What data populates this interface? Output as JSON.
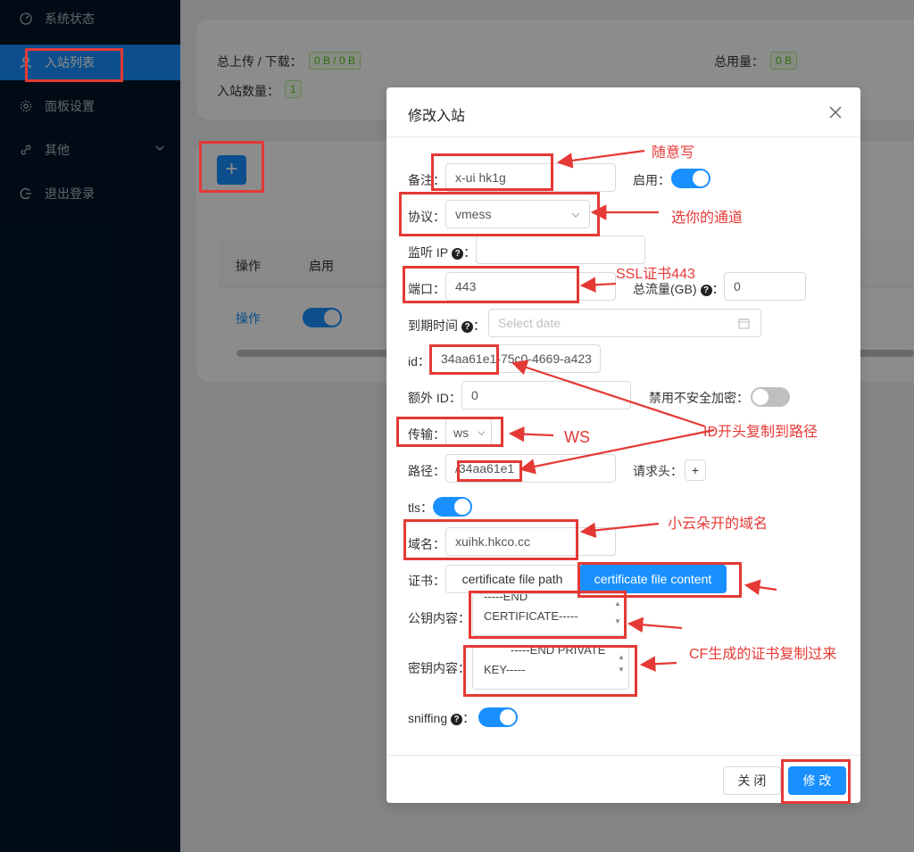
{
  "sidebar": {
    "items": [
      {
        "label": "系统状态",
        "icon": "dashboard-icon"
      },
      {
        "label": "入站列表",
        "icon": "user-icon"
      },
      {
        "label": "面板设置",
        "icon": "gear-icon"
      },
      {
        "label": "其他",
        "icon": "link-icon"
      },
      {
        "label": "退出登录",
        "icon": "logout-icon"
      }
    ]
  },
  "stats": {
    "traffic_label": "总上传 / 下载：",
    "traffic_value": "0 B / 0 B",
    "total_label": "总用量：",
    "total_value": "0 B",
    "count_label": "入站数量：",
    "count_value": "1"
  },
  "table": {
    "headers": [
      "操作",
      "启用"
    ],
    "row": {
      "action": "操作"
    }
  },
  "modal": {
    "title": "修改入站",
    "remark_label": "备注：",
    "remark_value": "x-ui hk1g",
    "enable_label": "启用：",
    "protocol_label": "协议：",
    "protocol_value": "vmess",
    "listen_label": "监听 IP",
    "port_label": "端口：",
    "port_value": "443",
    "total_traffic_label": "总流量(GB)",
    "total_traffic_value": "0",
    "expire_label": "到期时间",
    "expire_placeholder": "Select date",
    "id_label": "id：",
    "id_value": "34aa61e1-75c0-4669-a423",
    "alter_id_label": "额外 ID：",
    "alter_id_value": "0",
    "disable_insecure_label": "禁用不安全加密：",
    "transport_label": "传输：",
    "transport_value": "ws",
    "path_label": "路径：",
    "path_value": "/34aa61e1",
    "header_label": "请求头：",
    "header_add": "+",
    "tls_label": "tls：",
    "domain_label": "域名：",
    "domain_value": "xuihk.hkco.cc",
    "cert_label": "证书：",
    "cert_path_btn": "certificate file path",
    "cert_content_btn": "certificate file content",
    "pubkey_label": "公钥内容：",
    "pubkey_line1": "-----END",
    "pubkey_line2": "CERTIFICATE-----",
    "privkey_label": "密钥内容：",
    "privkey_line1": "-----END PRIVATE",
    "privkey_line2": "KEY-----",
    "sniffing_label": "sniffing",
    "close_btn": "关 闭",
    "submit_btn": "修 改"
  },
  "annotations": {
    "remark": "随意写",
    "protocol": "选你的通道",
    "port": "SSL证书443",
    "transport": "WS",
    "id_path": "ID开头复制到路径",
    "domain": "小云朵开的域名",
    "cert": "CF生成的证书复制过来"
  },
  "colors": {
    "sidebar_bg": "#001529",
    "primary": "#1890ff",
    "annotation": "#e53935"
  }
}
